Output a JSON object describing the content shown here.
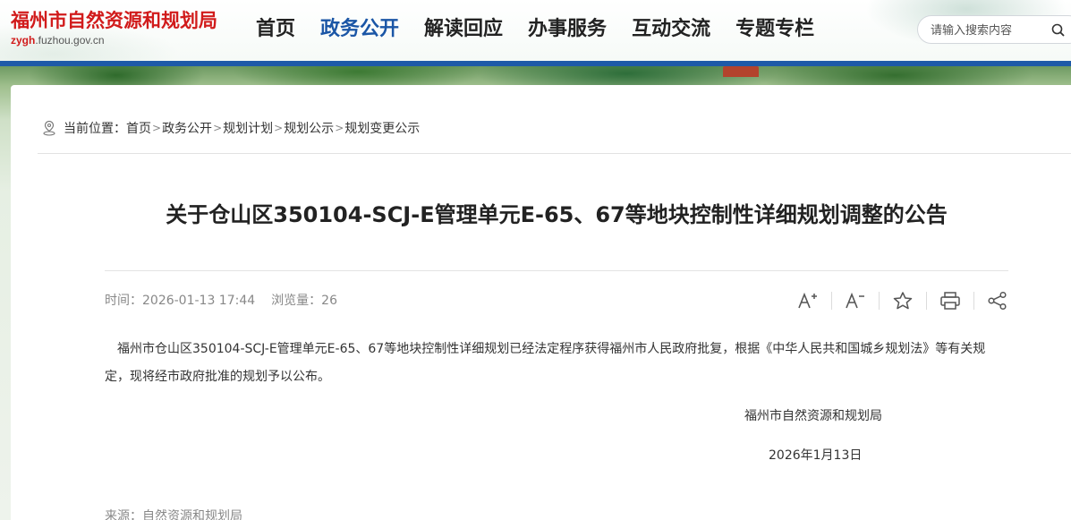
{
  "header": {
    "site_title": "福州市自然资源和规划局",
    "domain_prefix": "zygh",
    "domain_rest": ".fuzhou.gov.cn",
    "nav": [
      {
        "label": "首页"
      },
      {
        "label": "政务公开",
        "active": true
      },
      {
        "label": "解读回应"
      },
      {
        "label": "办事服务"
      },
      {
        "label": "互动交流"
      },
      {
        "label": "专题专栏"
      }
    ],
    "search_placeholder": "请输入搜索内容",
    "search_icon": "search-icon"
  },
  "breadcrumb": {
    "prefix": "当前位置：",
    "items": [
      "首页",
      "政务公开",
      "规划计划",
      "规划公示",
      "规划变更公示"
    ],
    "separator": ">"
  },
  "article": {
    "title": "关于仓山区350104-SCJ-E管理单元E-65、67等地块控制性详细规划调整的公告",
    "time_label": "时间：",
    "time_value": "2026-01-13 17:44",
    "views_label": "浏览量：",
    "views_value": "26",
    "tools": [
      "font-increase-icon",
      "font-decrease-icon",
      "star-icon",
      "print-icon",
      "share-icon"
    ],
    "body": "福州市仓山区350104-SCJ-E管理单元E-65、67等地块控制性详细规划已经法定程序获得福州市人民政府批复，根据《中华人民共和国城乡规划法》等有关规定，现将经市政府批准的规划予以公布。",
    "signature": "福州市自然资源和规划局",
    "date": "2026年1月13日",
    "source_label": "来源：",
    "source_value": "自然资源和规划局"
  },
  "colors": {
    "brand_red": "#d11b1b",
    "nav_active": "#1b56a6",
    "blue_bar": "#1e5aa8"
  }
}
